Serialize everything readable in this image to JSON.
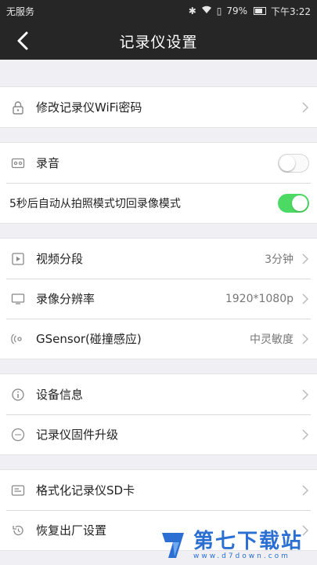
{
  "statusbar": {
    "carrier": "无服务",
    "battery": "79%",
    "time": "下午3:22"
  },
  "header": {
    "title": "记录仪设置"
  },
  "groups": {
    "wifi": {
      "label": "修改记录仪WiFi密码"
    },
    "audio": {
      "record_label": "录音",
      "record_on": false,
      "auto_switch_label": "5秒后自动从拍照模式切回录像模式",
      "auto_switch_on": true
    },
    "video": {
      "segment_label": "视频分段",
      "segment_value": "3分钟",
      "resolution_label": "录像分辨率",
      "resolution_value": "1920*1080p",
      "gsensor_label": "GSensor(碰撞感应)",
      "gsensor_value": "中灵敏度"
    },
    "device": {
      "info_label": "设备信息",
      "firmware_label": "记录仪固件升级"
    },
    "storage": {
      "format_label": "格式化记录仪SD卡",
      "reset_label": "恢复出厂设置"
    }
  },
  "watermark": {
    "title": "第七下载站",
    "url": "www.d7down.com"
  },
  "colors": {
    "bar": "#262626",
    "toggle_on": "#4cd964",
    "watermark": "#2a6fd1"
  }
}
